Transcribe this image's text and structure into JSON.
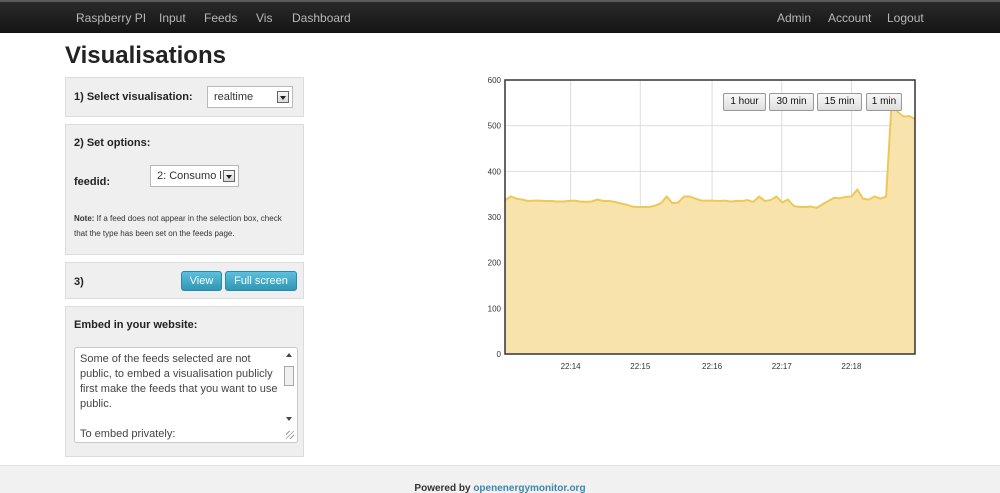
{
  "nav": {
    "left": [
      "Raspberry PI",
      "Input",
      "Feeds",
      "Vis",
      "Dashboard"
    ],
    "right": [
      "Admin",
      "Account",
      "Logout"
    ]
  },
  "page": {
    "title": "Visualisations"
  },
  "step1": {
    "label": "1) Select visualisation:",
    "selected": "realtime"
  },
  "step2": {
    "label": "2) Set options:",
    "feed_label": "feedid:",
    "feed_selected": "2: Consumo l",
    "note_bold": "Note:",
    "note_text": " If a feed does not appear in the selection box, check that the type has been set on the feeds page."
  },
  "step3": {
    "label": "3)",
    "view_label": "View",
    "fullscreen_label": "Full screen"
  },
  "embed": {
    "label": "Embed in your website:",
    "text": "Some of the feeds selected are not public, to embed a visualisation publicly first make the feeds that you want to use public.\n\nTo embed privately:"
  },
  "range_buttons": [
    "1 hour",
    "30 min",
    "15 min",
    "1 min"
  ],
  "footer": {
    "prefix": "Powered by ",
    "link": "openenergymonitor.org"
  },
  "colors": {
    "fill": "#f8e3ad",
    "line": "#ecc957",
    "button": "#49afcd",
    "navbar": "#1b1b1b"
  },
  "chart_data": {
    "type": "area",
    "x_ticks": [
      "22:14",
      "22:15",
      "22:16",
      "22:17",
      "22:18"
    ],
    "ylim": [
      0,
      600
    ],
    "y_ticks": [
      0,
      100,
      200,
      300,
      400,
      500,
      600
    ],
    "grid": true,
    "values": [
      337,
      345,
      340,
      338,
      335,
      336,
      336,
      335,
      335,
      334,
      334,
      335,
      336,
      334,
      333,
      334,
      338,
      335,
      335,
      333,
      330,
      327,
      323,
      322,
      322,
      322,
      325,
      330,
      345,
      330,
      332,
      345,
      345,
      340,
      336,
      336,
      336,
      335,
      336,
      334,
      335,
      335,
      337,
      333,
      345,
      335,
      337,
      345,
      332,
      338,
      324,
      322,
      322,
      323,
      320,
      328,
      335,
      342,
      341,
      344,
      345,
      360,
      340,
      338,
      345,
      340,
      345,
      560,
      530,
      520,
      521,
      515
    ]
  }
}
